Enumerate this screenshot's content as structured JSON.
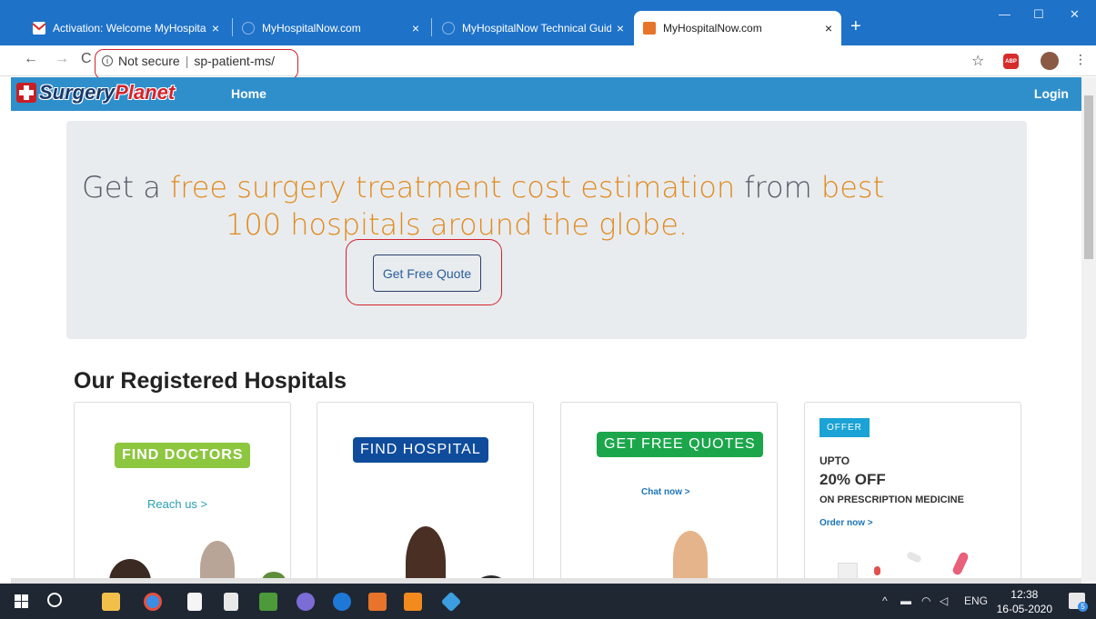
{
  "browser": {
    "tabs": [
      {
        "title": "Activation: Welcome MyHospital",
        "close": "×"
      },
      {
        "title": "MyHospitalNow.com",
        "close": "×"
      },
      {
        "title": "MyHospitalNow Technical Guide",
        "close": "×"
      },
      {
        "title": "MyHospitalNow.com",
        "close": "×"
      }
    ],
    "new_tab": "+",
    "window_buttons": {
      "minimize": "—",
      "maximize": "☐",
      "close": "✕"
    },
    "nav": {
      "back": "←",
      "forward": "→",
      "reload": "C"
    },
    "address": {
      "info_icon": "i",
      "security": "Not secure",
      "url": "sp-patient-ms/"
    },
    "bookmark_star": "☆",
    "abp_label": "ABP"
  },
  "site": {
    "brand": {
      "part1": "Surgery",
      "part2": "Planet"
    },
    "nav_home": "Home",
    "nav_login": "Login",
    "hero": {
      "line1_prefix": "Get a ",
      "line1_highlight": "free surgery treatment cost estimation",
      "line1_mid": " from ",
      "line1_end": "best",
      "line2": "100 hospitals around the globe.",
      "button": "Get Free Quote"
    },
    "section_title": "Our Registered Hospitals",
    "cards": [
      {
        "pill": "FIND DOCTORS",
        "link": "Reach us >"
      },
      {
        "pill": "FIND HOSPITAL"
      },
      {
        "pill": "GET FREE QUOTES",
        "link": "Chat now >"
      },
      {
        "badge": "OFFER",
        "line1": "UPTO",
        "line2": "20% OFF",
        "line3": "ON PRESCRIPTION MEDICINE",
        "link": "Order now >"
      }
    ]
  },
  "taskbar": {
    "tray_lang": "ENG",
    "time": "12:38",
    "date": "16-05-2020",
    "notification_count": "5"
  },
  "colors": {
    "tabstrip": "#1e72c8",
    "site_nav": "#2f8fcb",
    "hero_bg": "#e9ecef",
    "accent_orange": "#e08a1e",
    "annotation_red": "#d0212b"
  }
}
